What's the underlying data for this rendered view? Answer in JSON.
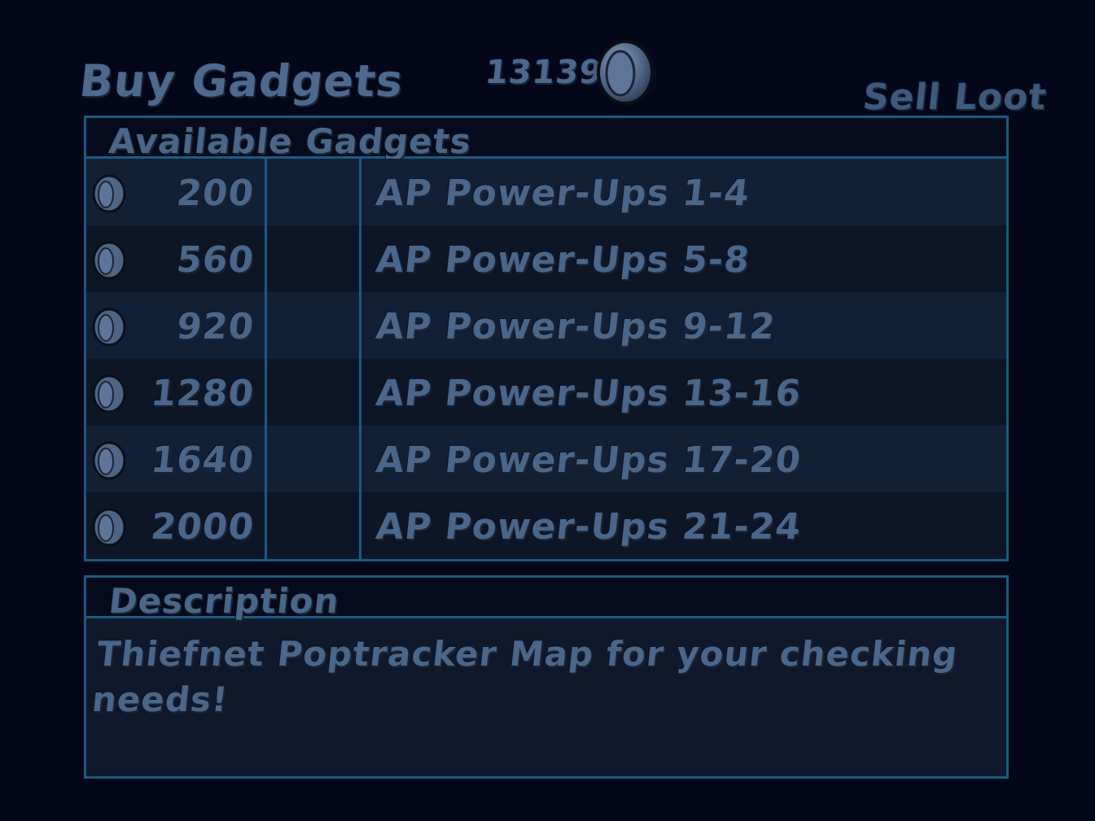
{
  "header": {
    "title": "Buy Gadgets",
    "coin_count": "13139",
    "sell_label": "Sell Loot"
  },
  "gadgets": {
    "header": "Available Gadgets",
    "items": [
      {
        "price": "200",
        "name": "AP Power-Ups 1-4"
      },
      {
        "price": "560",
        "name": "AP Power-Ups 5-8"
      },
      {
        "price": "920",
        "name": "AP Power-Ups 9-12"
      },
      {
        "price": "1280",
        "name": "AP Power-Ups 13-16"
      },
      {
        "price": "1640",
        "name": "AP Power-Ups 17-20"
      },
      {
        "price": "2000",
        "name": "AP Power-Ups 21-24"
      }
    ]
  },
  "description": {
    "header": "Description",
    "text": "Thiefnet Poptracker Map for your checking needs!"
  },
  "colors": {
    "background": "#04071a",
    "border": "#1a5b80",
    "text": "#4a6688"
  },
  "icons": {
    "currency": "coin-icon"
  }
}
